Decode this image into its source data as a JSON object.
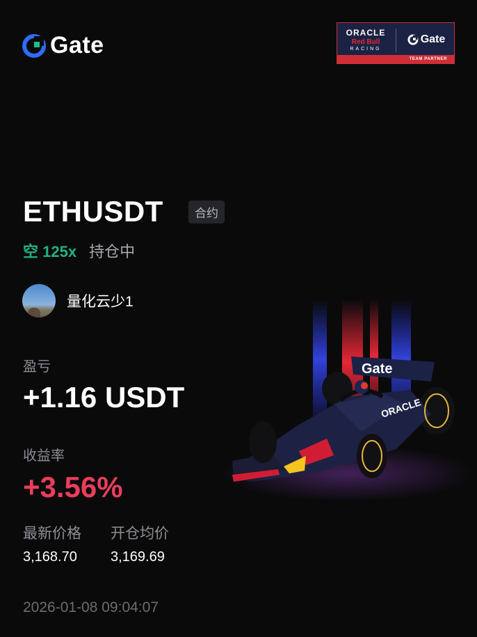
{
  "header": {
    "brand": "Gate",
    "partner": {
      "oracle": "ORACLE",
      "red_bull": "Red Bull",
      "racing": "RACING",
      "brand": "Gate",
      "caption": "TEAM PARTNER"
    }
  },
  "position": {
    "pair": "ETHUSDT",
    "type_tag": "合约",
    "side": "空 125x",
    "status": "持仓中"
  },
  "user": {
    "name": "量化云少1"
  },
  "pnl": {
    "label": "盈亏",
    "value": "+1.16 USDT"
  },
  "roi": {
    "label": "收益率",
    "value": "+3.56%"
  },
  "prices": {
    "latest_label": "最新价格",
    "entry_label": "开仓均价",
    "latest_value": "3,168.70",
    "entry_value": "3,169.69"
  },
  "timestamp": "2026-01-08 09:04:07",
  "art": {
    "car_wing_text": "Gate",
    "car_side_text": "ORACLE"
  },
  "icons": {
    "brand_logo": "gate-logo-icon",
    "avatar": "user-avatar"
  },
  "colors": {
    "background": "#0a0a0b",
    "short_green": "#21b382",
    "roi_red": "#ea3e5b",
    "muted": "#8c8e94",
    "partner_red": "#cf2e36",
    "partner_navy": "#1c2243"
  }
}
